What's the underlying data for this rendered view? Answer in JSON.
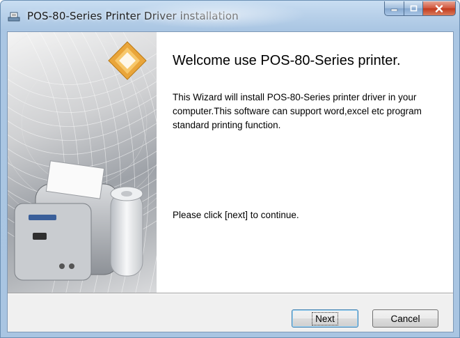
{
  "window": {
    "title": "POS-80-Series Printer Driver installation",
    "icon": "installer-app-icon"
  },
  "caption_buttons": {
    "minimize_icon": "minimize-icon",
    "maximize_icon": "maximize-icon",
    "close_icon": "close-icon",
    "close_color": "#c23a1e"
  },
  "content": {
    "heading": "Welcome use POS-80-Series printer.",
    "description": "This Wizard will install POS-80-Series printer driver in your computer.This software can support word,excel etc program standard printing function.",
    "continue_hint": "Please click [next] to continue."
  },
  "buttons": {
    "next_label": "Next",
    "cancel_label": "Cancel"
  },
  "banner": {
    "logo_icon": "orange-diamond-logo",
    "image": "thermal-receipt-printer-illustration",
    "logo_color": "#e9a53a"
  }
}
